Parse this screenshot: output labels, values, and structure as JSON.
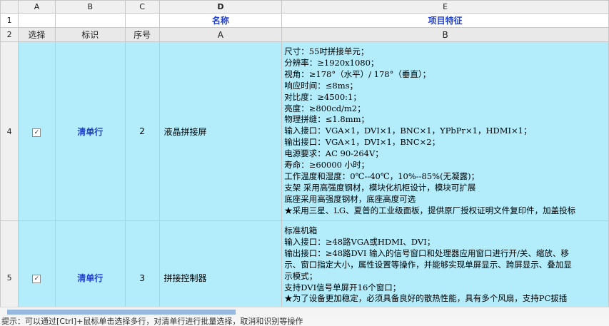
{
  "columns": [
    "A",
    "B",
    "C",
    "D",
    "E"
  ],
  "rows": {
    "r1": {
      "num": "1",
      "name_header": "名称",
      "feature_header": "项目特征"
    },
    "r2": {
      "num": "2",
      "select": "选择",
      "tag": "标识",
      "seq": "序号",
      "name_sub": "A",
      "feature_sub": "B"
    },
    "items": [
      {
        "num": "4",
        "checked": true,
        "tag": "清单行",
        "seq": "2",
        "name": "液晶拼接屏",
        "features": [
          "尺寸：55吋拼接单元；",
          "分辨率：≥1920x1080；",
          "视角：≥178°（水平）/ 178°（垂直）；",
          "响应时间：≤8ms；",
          "对比度：≥4500:1；",
          "亮度：≥800cd/m2；",
          "物理拼缝：≤1.8mm；",
          "输入接口：VGA×1，DVI×1，BNC×1，YPbPr×1，HDMI×1；",
          "输出接口：VGA×1，DVI×1，BNC×2；",
          "电源要求：AC 90-264V；",
          "寿命：≥60000 小时；",
          "工作温度和湿度：0℃--40℃，10%--85%(无凝露)；",
          "支架 采用高强度钢材，模块化机柜设计，模块可扩展",
          "底座采用高强度钢材，底座高度可选",
          "★采用三星、LG、夏普的工业级面板，提供原厂授权证明文件复印件，加盖投标"
        ]
      },
      {
        "num": "5",
        "checked": true,
        "tag": "清单行",
        "seq": "3",
        "name": "拼接控制器",
        "features": [
          "标准机箱",
          "输入接口：≥48路VGA或HDMI、DVI；",
          "输出接口：≥48路DVI 输入的信号窗口和处理器应用窗口进行开/关、缩放、移",
          "示、窗口指定大小，属性设置等操作，并能够实现单屏显示、跨屏显示、叠加显",
          "示模式；",
          "支持DVI信号单屏开16个窗口；",
          "★为了设备更加稳定，必须具备良好的散热性能，具有多个风扇，支持PC拔插"
        ]
      }
    ]
  },
  "status_text": "提示：可以通过[Ctrl]+鼠标单击选择多行，对清单行进行批量选择，取消和识别等操作"
}
